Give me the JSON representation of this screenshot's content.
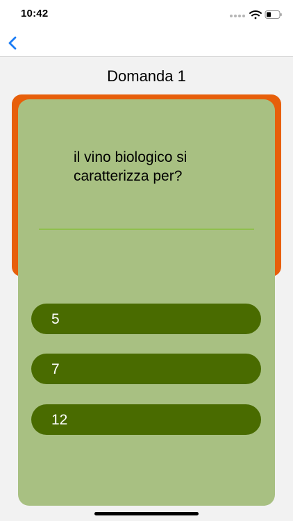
{
  "status_bar": {
    "time": "10:42"
  },
  "nav": {
    "back_icon": "chevron-left-icon",
    "accent_color": "#1a7cf5"
  },
  "title": "Domanda 1",
  "quiz": {
    "question": "il vino biologico si caratterizza per?",
    "answers": [
      {
        "label": "5"
      },
      {
        "label": "7"
      },
      {
        "label": "12"
      }
    ]
  },
  "colors": {
    "back_card": "#e75f0a",
    "front_card": "#a8c082",
    "answer_button": "#496b00"
  }
}
